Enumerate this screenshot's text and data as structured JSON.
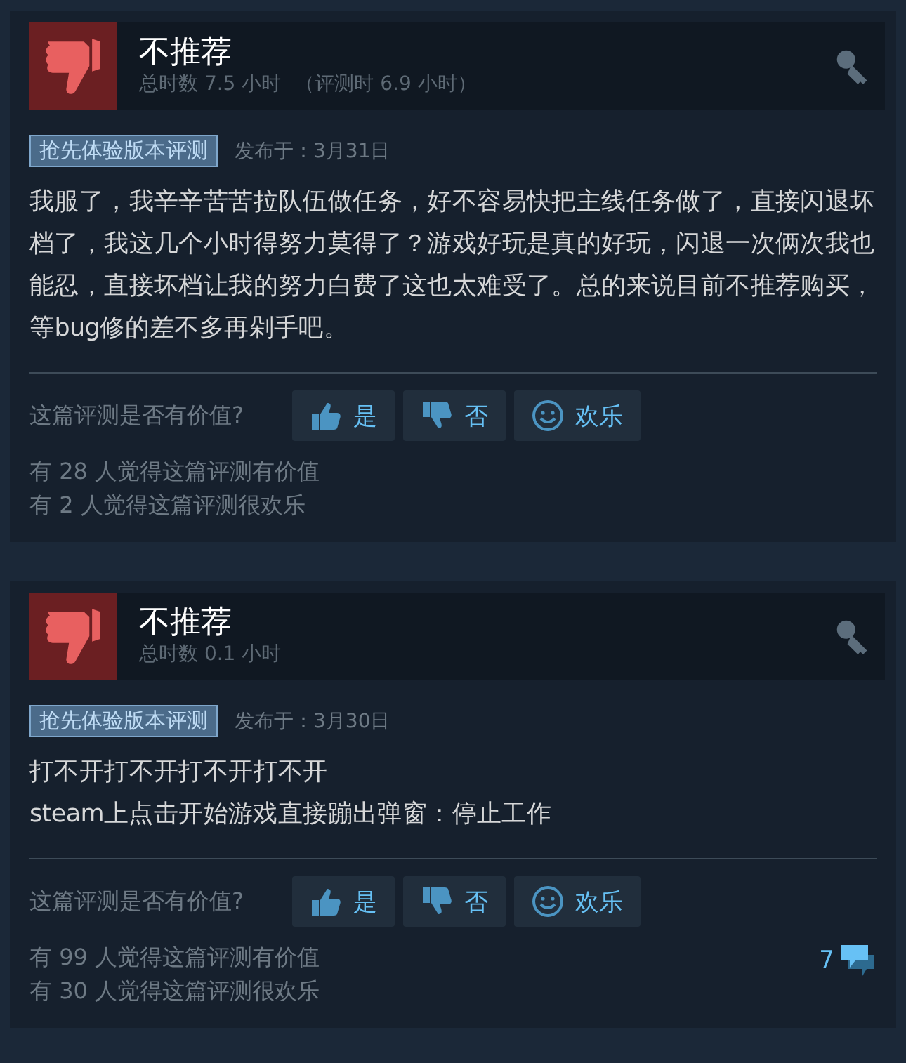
{
  "reviews": [
    {
      "verdict": "不推荐",
      "playtime": "总时数 7.5 小时",
      "playtime_at_review": "（评测时 6.9 小时）",
      "tag": "抢先体验版本评测",
      "posted": "发布于：3月31日",
      "body": [
        "我服了，我辛辛苦苦拉队伍做任务，好不容易快把主线任务做了，直接闪退坏档了，我这几个小时得努力莫得了？游戏好玩是真的好玩，闪退一次俩次我也能忍，直接坏档让我的努力白费了这也太难受了。总的来说目前不推荐购买，等bug修的差不多再剁手吧。"
      ],
      "question": "这篇评测是否有价值?",
      "buttons": [
        {
          "kind": "yes",
          "label": "是"
        },
        {
          "kind": "no",
          "label": "否"
        },
        {
          "kind": "funny",
          "label": "欢乐"
        }
      ],
      "stats": [
        "有 28 人觉得这篇评测有价值",
        "有 2 人觉得这篇评测很欢乐"
      ]
    },
    {
      "verdict": "不推荐",
      "playtime": "总时数 0.1 小时",
      "tag": "抢先体验版本评测",
      "posted": "发布于：3月30日",
      "body": [
        "打不开打不开打不开打不开",
        "steam上点击开始游戏直接蹦出弹窗：停止工作"
      ],
      "question": "这篇评测是否有价值?",
      "buttons": [
        {
          "kind": "yes",
          "label": "是"
        },
        {
          "kind": "no",
          "label": "否"
        },
        {
          "kind": "funny",
          "label": "欢乐"
        }
      ],
      "stats": [
        "有 99 人觉得这篇评测有价值",
        "有 30 人觉得这篇评测很欢乐"
      ],
      "comments": "7"
    }
  ]
}
